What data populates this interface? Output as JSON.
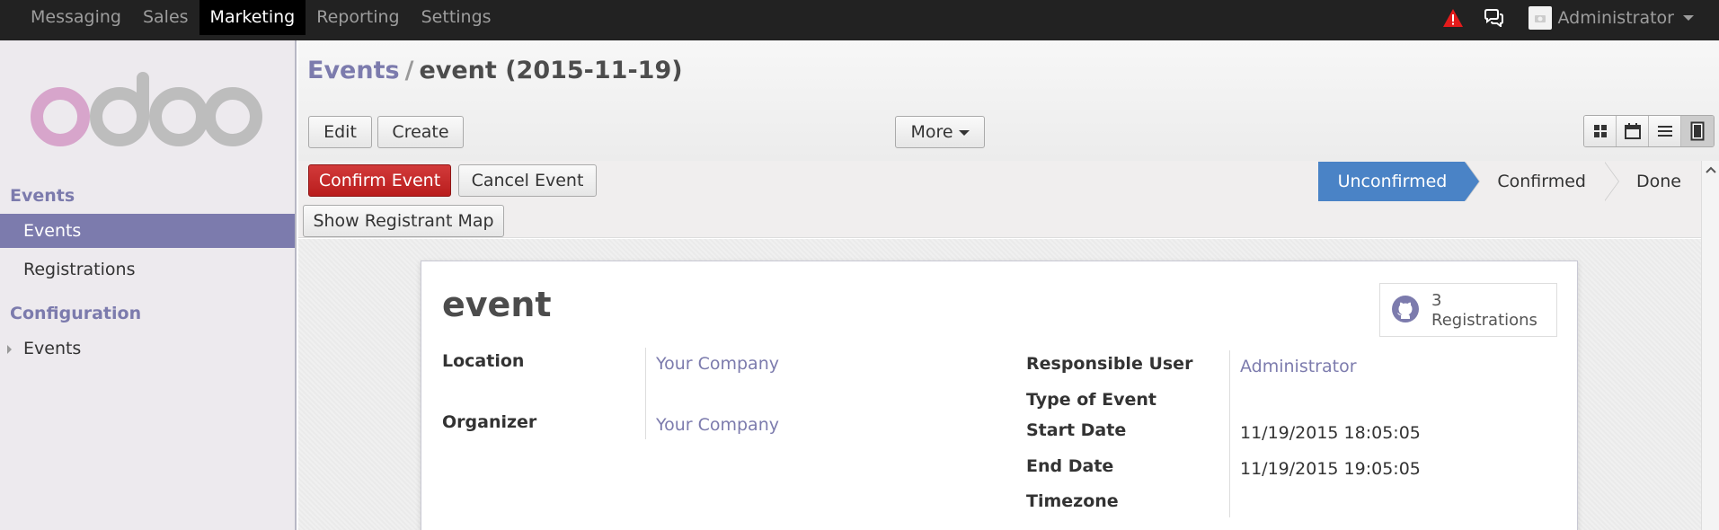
{
  "topmenu": {
    "items": [
      "Messaging",
      "Sales",
      "Marketing",
      "Reporting",
      "Settings"
    ],
    "active": "Marketing"
  },
  "user": {
    "name": "Administrator"
  },
  "sidebar": {
    "section1": "Events",
    "items": [
      "Events",
      "Registrations"
    ],
    "section2": "Configuration",
    "config_items": [
      "Events"
    ]
  },
  "breadcrumb": {
    "parent": "Events",
    "separator": "/",
    "current": "event (2015-11-19)"
  },
  "toolbar": {
    "edit": "Edit",
    "create": "Create",
    "more": "More"
  },
  "actions": {
    "confirm": "Confirm Event",
    "cancel": "Cancel Event",
    "show_map": "Show Registrant Map"
  },
  "stages": {
    "items": [
      "Unconfirmed",
      "Confirmed",
      "Done"
    ],
    "active": "Unconfirmed"
  },
  "form": {
    "title": "event",
    "stat": {
      "count": "3",
      "label": "Registrations"
    },
    "left": [
      {
        "label": "Location",
        "value": "Your Company"
      },
      {
        "label": "Organizer",
        "value": "Your Company"
      }
    ],
    "right": [
      {
        "label": "Responsible User",
        "value": "Administrator"
      },
      {
        "label": "Type of Event",
        "value": ""
      },
      {
        "label": "Start Date",
        "value": "11/19/2015 18:05:05"
      },
      {
        "label": "End Date",
        "value": "11/19/2015 19:05:05"
      },
      {
        "label": "Timezone",
        "value": ""
      }
    ]
  },
  "colors": {
    "brand": "#7c7bad",
    "primary": "#c62a2a",
    "stage_active": "#4a83c6",
    "alert": "#e31b1b"
  }
}
